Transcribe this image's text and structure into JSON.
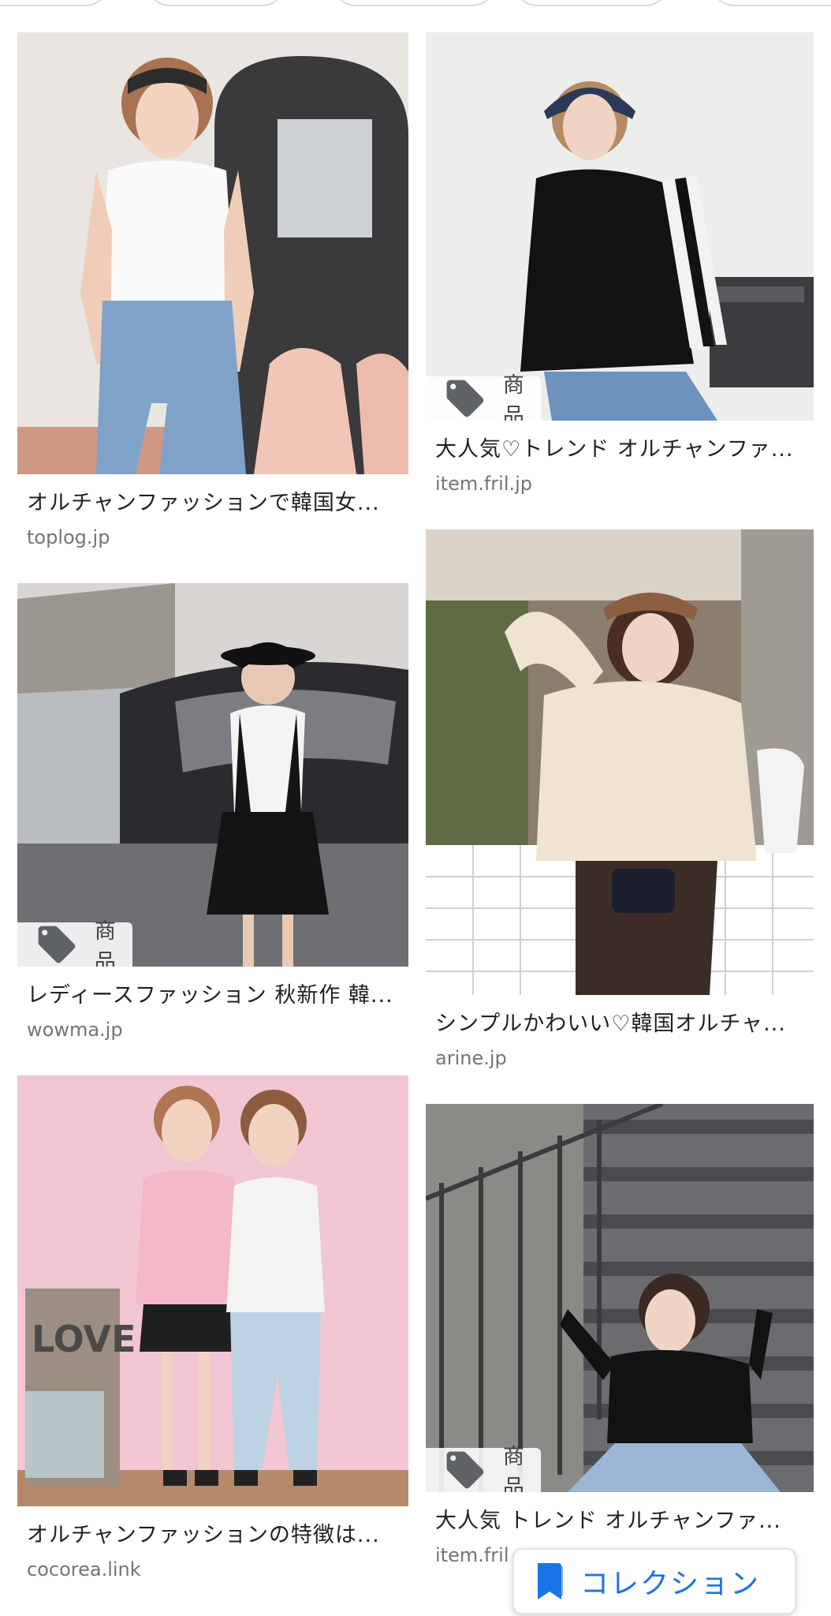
{
  "collection_button": {
    "label": "コレクション"
  },
  "results": {
    "left": [
      {
        "title": "オルチャンファッションで韓国女...",
        "source": "toplog.jp",
        "product_tag": null
      },
      {
        "title": "レディースファッション 秋新作 韓...",
        "source": "wowma.jp",
        "product_tag": "商品"
      },
      {
        "title": "オルチャンファッションの特徴は...",
        "source": "cocorea.link",
        "product_tag": null
      }
    ],
    "right": [
      {
        "title": "大人気♡トレンド オルチャンファ...",
        "source": "item.fril.jp",
        "product_tag": "商品"
      },
      {
        "title": "シンプルかわいい♡韓国オルチャ...",
        "source": "arine.jp",
        "product_tag": null
      },
      {
        "title": "大人気 トレンド オルチャンファ...",
        "source": "item.fril",
        "product_tag": "商品"
      }
    ]
  },
  "colors": {
    "accent": "#1a73e8",
    "source_text": "#70757a"
  }
}
